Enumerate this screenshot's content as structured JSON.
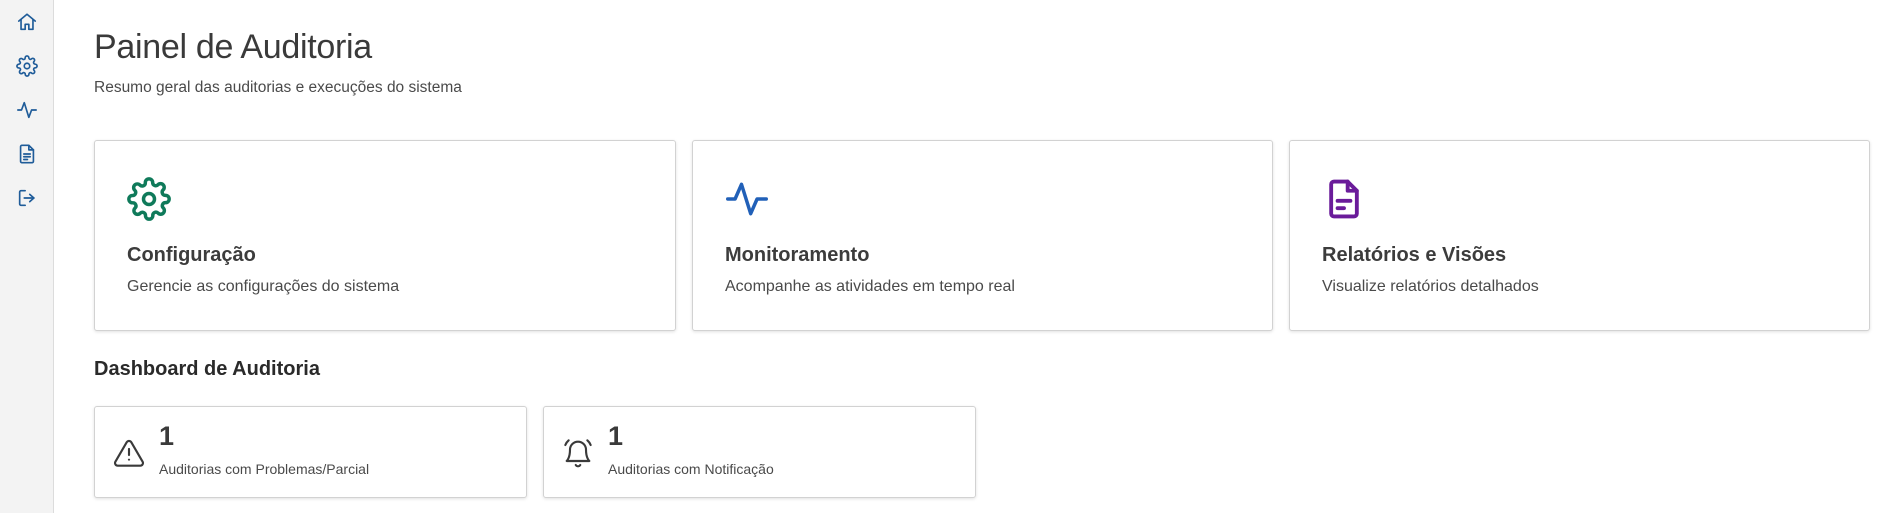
{
  "sidebar": {
    "items": [
      {
        "name": "home",
        "icon": "home-icon"
      },
      {
        "name": "settings",
        "icon": "gear-icon"
      },
      {
        "name": "activity",
        "icon": "activity-icon"
      },
      {
        "name": "reports",
        "icon": "document-icon"
      },
      {
        "name": "logout",
        "icon": "logout-icon"
      }
    ],
    "icon_color": "#1f5c99"
  },
  "header": {
    "title": "Painel de Auditoria",
    "subtitle": "Resumo geral das auditorias e execuções do sistema"
  },
  "feature_cards": [
    {
      "title": "Configuração",
      "description": "Gerencie as configurações do sistema",
      "icon": "gear-icon",
      "color": "#0f7a5a"
    },
    {
      "title": "Monitoramento",
      "description": "Acompanhe as atividades em tempo real",
      "icon": "activity-icon",
      "color": "#2160b8"
    },
    {
      "title": "Relatórios e Visões",
      "description": "Visualize relatórios detalhados",
      "icon": "document-icon",
      "color": "#6a1b9a"
    }
  ],
  "dashboard": {
    "title": "Dashboard de Auditoria",
    "stats": [
      {
        "value": "1",
        "label": "Auditorias com Problemas/Parcial",
        "icon": "warning-icon"
      },
      {
        "value": "1",
        "label": "Auditorias com Notificação",
        "icon": "bell-icon"
      }
    ]
  }
}
